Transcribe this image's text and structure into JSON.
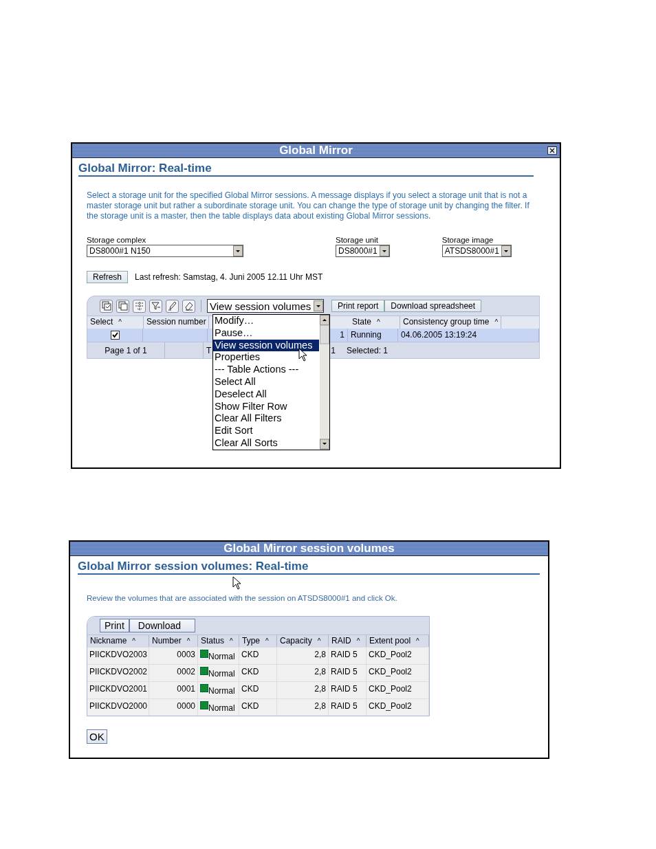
{
  "mirror_window": {
    "title": "Global Mirror",
    "page_title": "Global Mirror: Real-time",
    "description": "Select a storage unit for the specified Global Mirror sessions. A message displays if you select a storage unit that is not a master storage unit but rather a subordinate storage unit. You can change the type of storage unit by changing the filter. If the storage unit is a master, then the table displays data about existing Global Mirror sessions.",
    "filters": [
      {
        "label": "Storage complex",
        "value": "DS8000#1 N150"
      },
      {
        "label": "Storage unit",
        "value": "DS8000#1"
      },
      {
        "label": "Storage image",
        "value": "ATSDS8000#1"
      }
    ],
    "refresh_button": "Refresh",
    "last_refresh": "Last refresh: Samstag, 4. Juni 2005 12.11 Uhr MST",
    "action_select": {
      "value": "View session volumes",
      "expanded": true,
      "options": [
        {
          "label": "Modify…",
          "selected": false
        },
        {
          "label": "Pause…",
          "selected": false
        },
        {
          "label": "View session volumes",
          "selected": true
        },
        {
          "label": "Properties",
          "selected": false
        },
        {
          "label": "--- Table Actions ---",
          "selected": false
        },
        {
          "label": "Select All",
          "selected": false
        },
        {
          "label": "Deselect All",
          "selected": false
        },
        {
          "label": "Show Filter Row",
          "selected": false
        },
        {
          "label": "Clear All Filters",
          "selected": false
        },
        {
          "label": "Edit Sort",
          "selected": false
        },
        {
          "label": "Clear All Sorts",
          "selected": false
        }
      ]
    },
    "toolbar_buttons": [
      "Print report",
      "Download spreadsheet"
    ],
    "table": {
      "columns": [
        {
          "label": "Select",
          "sort": "^"
        },
        {
          "label": "Session number"
        },
        {
          "label": "State",
          "sort": "^"
        },
        {
          "label": "Consistency group time",
          "sort": "^"
        }
      ],
      "rows": [
        {
          "selected": true,
          "checked": true,
          "column_3": "1",
          "state": "Running",
          "consistency_group_time": "04.06.2005 13:19:24"
        }
      ],
      "footer": {
        "page": "Page 1 of 1",
        "column_3": "T",
        "total": "1",
        "selected": "Selected: 1"
      }
    }
  },
  "volumes_window": {
    "title": "Global Mirror session volumes",
    "page_title": "Global Mirror session volumes: Real-time",
    "description": "Review the volumes that are associated with the session on ATSDS8000#1 and click Ok.",
    "buttons": [
      "Print",
      "Download"
    ],
    "table": {
      "columns": [
        {
          "label": "Nickname",
          "sort": "^"
        },
        {
          "label": "Number",
          "sort": "^"
        },
        {
          "label": "Status",
          "sort": "^"
        },
        {
          "label": "Type",
          "sort": "^"
        },
        {
          "label": "Capacity",
          "sort": "^"
        },
        {
          "label": "RAID",
          "sort": "^"
        },
        {
          "label": "Extent pool",
          "sort": "^"
        }
      ],
      "rows": [
        {
          "nickname": "PIICKDVO2003",
          "number": "0003",
          "status": "Normal",
          "type": "CKD",
          "capacity": "2,8",
          "raid": "RAID 5",
          "extent_pool": "CKD_Pool2"
        },
        {
          "nickname": "PIICKDVO2002",
          "number": "0002",
          "status": "Normal",
          "type": "CKD",
          "capacity": "2,8",
          "raid": "RAID 5",
          "extent_pool": "CKD_Pool2"
        },
        {
          "nickname": "PIICKDVO2001",
          "number": "0001",
          "status": "Normal",
          "type": "CKD",
          "capacity": "2,8",
          "raid": "RAID 5",
          "extent_pool": "CKD_Pool2"
        },
        {
          "nickname": "PIICKDVO2000",
          "number": "0000",
          "status": "Normal",
          "type": "CKD",
          "capacity": "2,8",
          "raid": "RAID 5",
          "extent_pool": "CKD_Pool2"
        }
      ]
    },
    "ok_button": "OK"
  }
}
